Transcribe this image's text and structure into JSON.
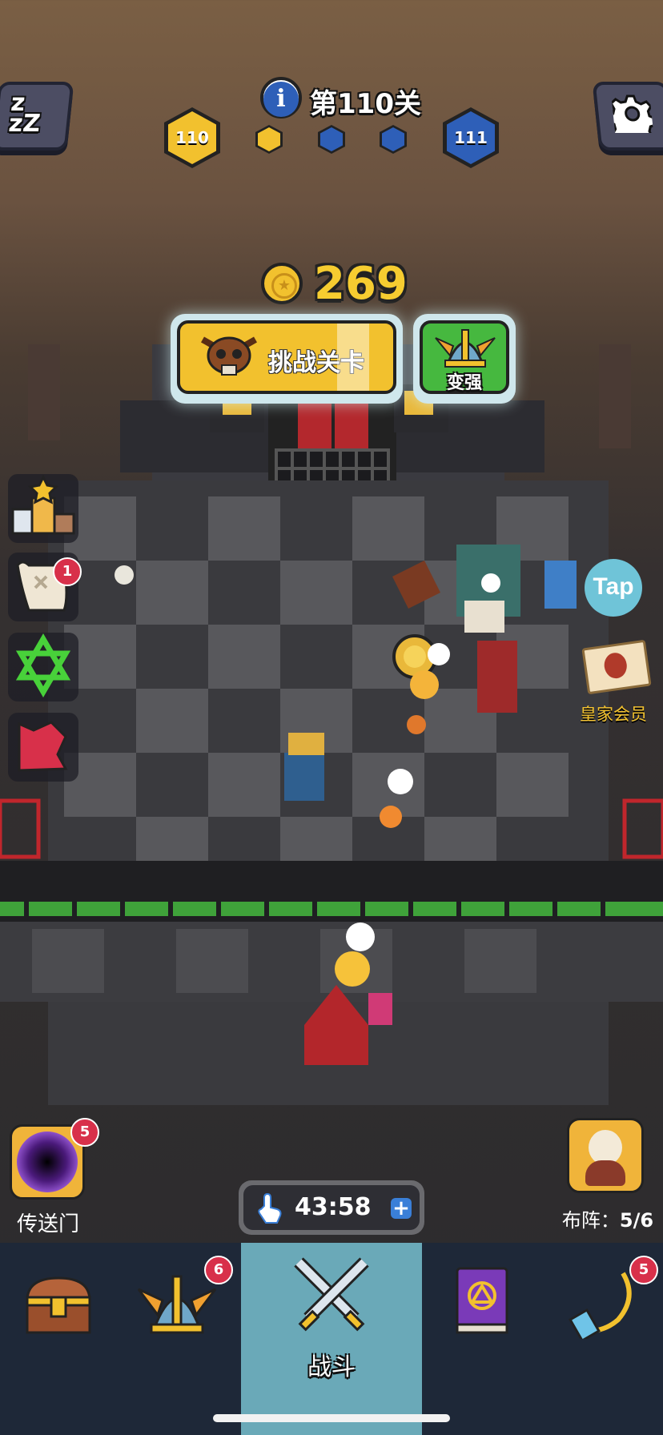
{
  "header": {
    "level_title": "第110关",
    "current_level": "110",
    "next_level": "111"
  },
  "reward": {
    "coins": "269",
    "challenge_label": "挑战关卡",
    "upgrade_label": "变强"
  },
  "left_panel": {
    "scroll_badge": "1"
  },
  "right_panel": {
    "tap_label": "Tap",
    "vip_label": "皇家会员"
  },
  "portal": {
    "badge": "5",
    "label": "传送门"
  },
  "formation": {
    "label": "布阵：",
    "count": "5/6"
  },
  "timer": {
    "value": "43:58",
    "plus": "+"
  },
  "bottom_nav": [
    {
      "label": "",
      "icon": "chest-icon"
    },
    {
      "label": "",
      "icon": "winged-helmet-icon",
      "badge": "6"
    },
    {
      "label": "战斗",
      "icon": "crossed-swords-icon"
    },
    {
      "label": "",
      "icon": "spellbook-icon"
    },
    {
      "label": "",
      "icon": "amulet-icon",
      "badge": "5"
    }
  ],
  "colors": {
    "gold": "#f2c12e",
    "blue_hex": "#2e5fb8",
    "green_btn": "#46b83f",
    "nav_active": "#6aa9b8",
    "badge_red": "#d8304a"
  }
}
